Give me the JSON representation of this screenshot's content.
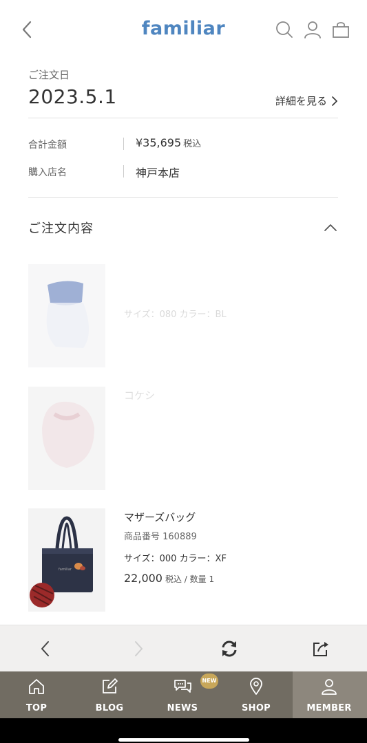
{
  "header": {
    "logo": "familiar",
    "icons": [
      "chevron-left-icon",
      "search-icon",
      "user-icon",
      "bag-icon"
    ]
  },
  "order": {
    "date_label": "ご注文日",
    "date_value": "2023.5.1",
    "detail_link": "詳細を見る",
    "total_label": "合計金額",
    "total_value": "¥35,695",
    "total_unit": "税込",
    "store_label": "購入店名",
    "store_value": "神戸本店"
  },
  "section": {
    "title": "ご注文内容"
  },
  "products": [
    {
      "name": "",
      "code": "",
      "spec": "サイズ：080 カラー：BL",
      "price": "",
      "price_note": ""
    },
    {
      "name": "コケシ",
      "code": "",
      "spec": "",
      "price": "",
      "price_note": ""
    },
    {
      "name": "マザーズバッグ",
      "code": "商品番号 160889",
      "spec": "サイズ：000 カラー：XF",
      "price": "22,000",
      "price_note": "税込 / 数量 1"
    }
  ],
  "browser_bar": {
    "icons": [
      "back-arrow-icon",
      "forward-arrow-icon",
      "reload-icon",
      "share-icon"
    ]
  },
  "tabbar": {
    "items": [
      {
        "label": "TOP",
        "icon": "home-icon"
      },
      {
        "label": "BLOG",
        "icon": "edit-icon"
      },
      {
        "label": "NEWS",
        "icon": "chat-icon"
      },
      {
        "label": "SHOP",
        "icon": "location-pin-icon"
      },
      {
        "label": "MEMBER",
        "icon": "user-icon"
      }
    ],
    "active": "MEMBER",
    "news_badge": "NEW"
  },
  "colors": {
    "logo": "#4f86c0",
    "tabbar": "#716c62",
    "tabbar_active": "#8d877d",
    "badge": "#c8a75a"
  }
}
